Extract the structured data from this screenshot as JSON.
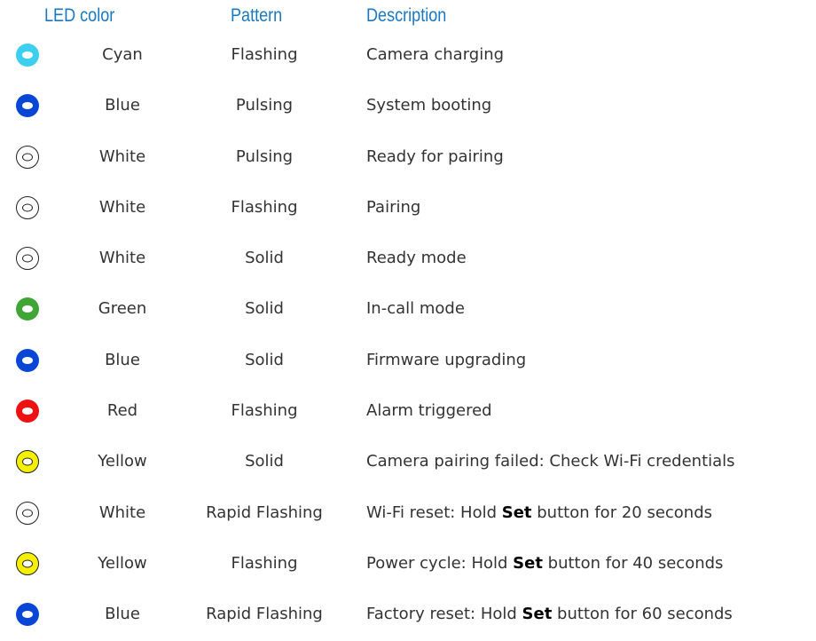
{
  "header": {
    "led_color": "LED color",
    "pattern": "Pattern",
    "description": "Description"
  },
  "rows": [
    {
      "icon": "led-dot-icon",
      "dot_color": "#3dd0ee",
      "outline": false,
      "color": "Cyan",
      "pattern": "Flashing",
      "desc_pre": "Camera charging",
      "desc_bold": "",
      "desc_post": ""
    },
    {
      "icon": "led-dot-icon",
      "dot_color": "#0a46d6",
      "outline": false,
      "color": "Blue",
      "pattern": "Pulsing",
      "desc_pre": "System booting",
      "desc_bold": "",
      "desc_post": ""
    },
    {
      "icon": "led-ring-icon",
      "dot_color": "#ffffff",
      "outline": true,
      "color": "White",
      "pattern": "Pulsing",
      "desc_pre": "Ready for pairing",
      "desc_bold": "",
      "desc_post": ""
    },
    {
      "icon": "led-ring-icon",
      "dot_color": "#ffffff",
      "outline": true,
      "color": "White",
      "pattern": "Flashing",
      "desc_pre": "Pairing",
      "desc_bold": "",
      "desc_post": ""
    },
    {
      "icon": "led-ring-icon",
      "dot_color": "#ffffff",
      "outline": true,
      "color": "White",
      "pattern": "Solid",
      "desc_pre": "Ready mode",
      "desc_bold": "",
      "desc_post": ""
    },
    {
      "icon": "led-dot-icon",
      "dot_color": "#3fa535",
      "outline": false,
      "color": "Green",
      "pattern": "Solid",
      "desc_pre": "In-call mode",
      "desc_bold": "",
      "desc_post": ""
    },
    {
      "icon": "led-dot-icon",
      "dot_color": "#0a46d6",
      "outline": false,
      "color": "Blue",
      "pattern": "Solid",
      "desc_pre": "Firmware upgrading",
      "desc_bold": "",
      "desc_post": ""
    },
    {
      "icon": "led-dot-icon",
      "dot_color": "#ee1111",
      "outline": false,
      "color": "Red",
      "pattern": "Flashing",
      "desc_pre": "Alarm triggered",
      "desc_bold": "",
      "desc_post": ""
    },
    {
      "icon": "led-ring-icon",
      "dot_color": "#f5f000",
      "outline": true,
      "color": "Yellow",
      "pattern": "Solid",
      "desc_pre": "Camera pairing failed: Check Wi-Fi credentials",
      "desc_bold": "",
      "desc_post": ""
    },
    {
      "icon": "led-ring-icon",
      "dot_color": "#ffffff",
      "outline": true,
      "color": "White",
      "pattern": "Rapid Flashing",
      "desc_pre": "Wi-Fi reset: Hold ",
      "desc_bold": "Set",
      "desc_post": " button for 20 seconds"
    },
    {
      "icon": "led-ring-icon",
      "dot_color": "#f5f000",
      "outline": true,
      "color": "Yellow",
      "pattern": "Flashing",
      "desc_pre": "Power cycle: Hold ",
      "desc_bold": "Set",
      "desc_post": " button for 40 seconds"
    },
    {
      "icon": "led-dot-icon",
      "dot_color": "#0a46d6",
      "outline": false,
      "color": "Blue",
      "pattern": "Rapid Flashing",
      "desc_pre": "Factory reset: Hold ",
      "desc_bold": "Set",
      "desc_post": " button for 60 seconds"
    }
  ]
}
